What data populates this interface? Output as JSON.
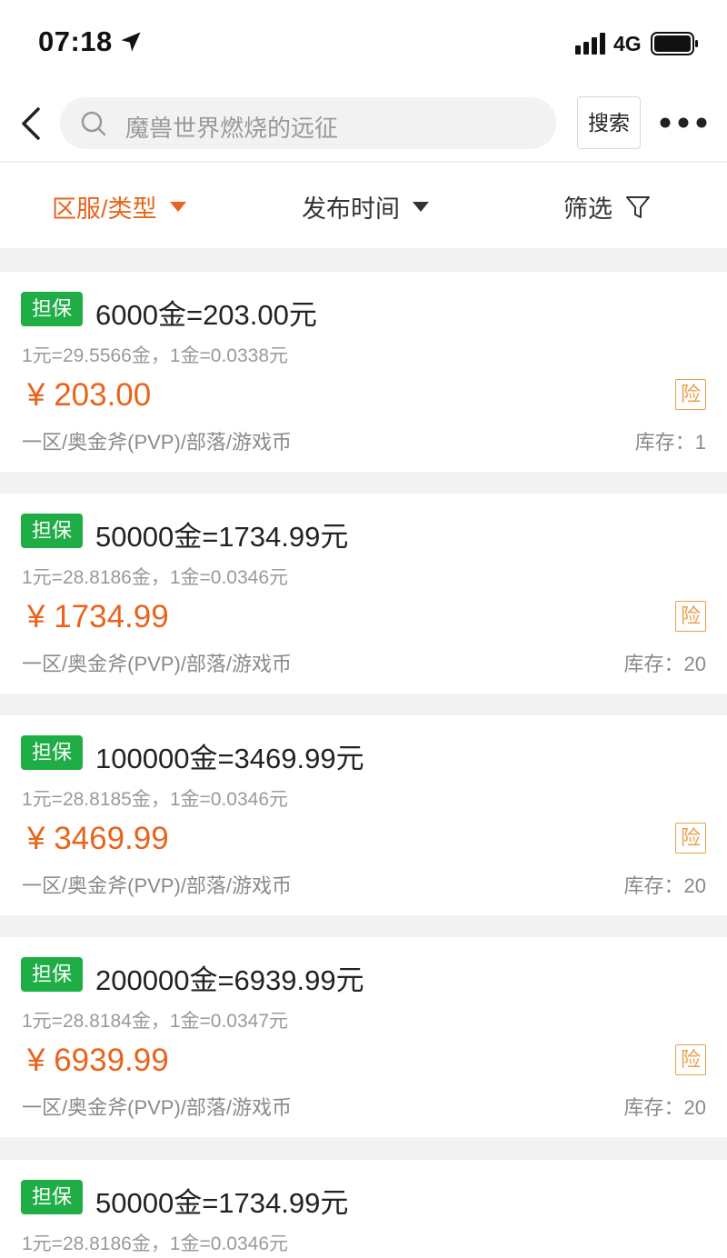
{
  "status_bar": {
    "time": "07:18",
    "network": "4G"
  },
  "nav": {
    "search_placeholder": "魔兽世界燃烧的远征",
    "search_button": "搜索"
  },
  "filters": {
    "region": "区服/类型",
    "time": "发布时间",
    "screen": "筛选"
  },
  "colors": {
    "accent": "#e8641c",
    "badge": "#1fae46",
    "insure": "#e8a04a"
  },
  "listings": [
    {
      "badge": "担保",
      "title": "6000金=203.00元",
      "rate": "1元=29.5566金，1金=0.0338元",
      "price": "¥ 203.00",
      "insure": "险",
      "tags": "一区/奥金斧(PVP)/部落/游戏币",
      "stock": "库存：1"
    },
    {
      "badge": "担保",
      "title": "50000金=1734.99元",
      "rate": "1元=28.8186金，1金=0.0346元",
      "price": "¥ 1734.99",
      "insure": "险",
      "tags": "一区/奥金斧(PVP)/部落/游戏币",
      "stock": "库存：20"
    },
    {
      "badge": "担保",
      "title": "100000金=3469.99元",
      "rate": "1元=28.8185金，1金=0.0346元",
      "price": "¥ 3469.99",
      "insure": "险",
      "tags": "一区/奥金斧(PVP)/部落/游戏币",
      "stock": "库存：20"
    },
    {
      "badge": "担保",
      "title": "200000金=6939.99元",
      "rate": "1元=28.8184金，1金=0.0347元",
      "price": "¥ 6939.99",
      "insure": "险",
      "tags": "一区/奥金斧(PVP)/部落/游戏币",
      "stock": "库存：20"
    },
    {
      "badge": "担保",
      "title": "50000金=1734.99元",
      "rate": "1元=28.8186金，1金=0.0346元",
      "price": "",
      "insure": "",
      "tags": "",
      "stock": ""
    }
  ]
}
